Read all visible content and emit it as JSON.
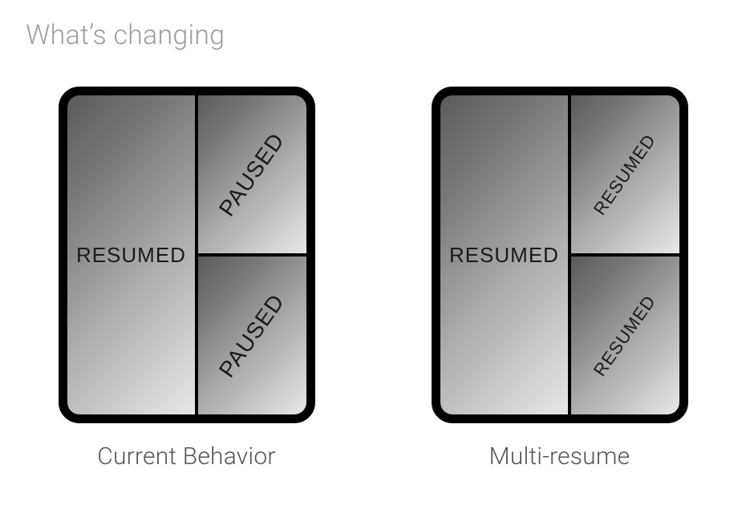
{
  "title": "What’s changing",
  "devices": [
    {
      "caption": "Current Behavior",
      "left_state": "RESUMED",
      "right_top_state": "PAUSED",
      "right_bottom_state": "PAUSED"
    },
    {
      "caption": "Multi-resume",
      "left_state": "RESUMED",
      "right_top_state": "RESUMED",
      "right_bottom_state": "RESUMED"
    }
  ]
}
